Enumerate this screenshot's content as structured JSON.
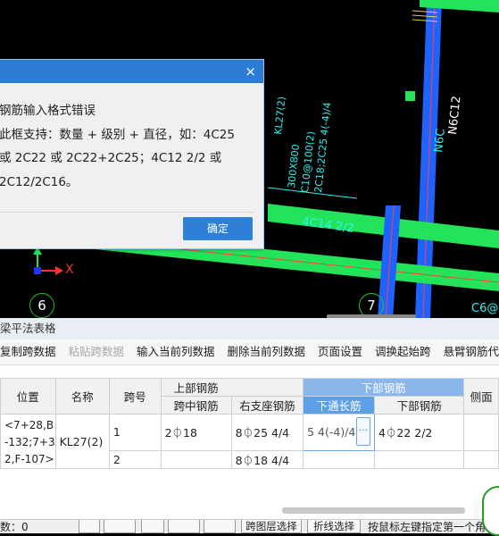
{
  "dialog": {
    "close_glyph": "×",
    "line1": "钢筋输入格式错误",
    "line2": "此框支持：数量 + 级别 + 直径，如：4C25",
    "line3": "或 2C22 或 2C22+2C25；4C12 2/2 或",
    "line4": "2C12/2C16。",
    "ok_label": "确定"
  },
  "cad": {
    "axis_6": "6",
    "axis_7": "7",
    "x_axis_label": "X",
    "beam_label_lines": [
      "KL27(2)",
      "300X800",
      "C10@100(2)",
      "2C18;2C25 4(-4)/4"
    ],
    "bottom_rebar_label": "4C14 2/2",
    "column_label_a": "N6C12",
    "column_label_b": "N6C",
    "corner_label": "C6@"
  },
  "panel": {
    "title": "梁平法表格",
    "toolbar": [
      "复制跨数据",
      "粘贴跨数据",
      "输入当前列数据",
      "删除当前列数据",
      "页面设置",
      "调换起始跨",
      "悬臂钢筋代号"
    ],
    "toolbar_disabled_index": 1,
    "headers": {
      "position": "位置",
      "name": "名称",
      "span": "跨号",
      "top_rebar": "上部钢筋",
      "bottom_rebar": "下部钢筋",
      "mid_span": "跨中钢筋",
      "right_support": "右支座钢筋",
      "bottom_through": "下通长筋",
      "bottom_bar": "下部钢筋",
      "side": "侧面"
    },
    "rows": [
      {
        "position": "<7+28,B-132;7+32,F-107>",
        "name": "KL27(2)",
        "span": "1",
        "mid_span": "2⏀18",
        "right_support": "8⏀25 4/4",
        "bottom_through": "5 4(-4)/4",
        "bottom_bar": "4⏀22 2/2"
      },
      {
        "span": "2",
        "mid_span": "",
        "right_support": "8⏀18 4/4",
        "bottom_through": "",
        "bottom_bar": ""
      }
    ],
    "position_lines": [
      "<7+28,B",
      "-132;7+3",
      "2,F-107>"
    ],
    "ellipsis": "···"
  },
  "status": {
    "left_text": "数：0",
    "btn_span_layer": "跨图层选择",
    "btn_polyline": "折线选择",
    "hint": "按鼠标左键指定第一个角"
  },
  "colors": {
    "beam_green": "#22e35a",
    "column_blue": "#1f63ff",
    "cad_text": "#2ff0ee",
    "accent": "#2b7cd3"
  }
}
